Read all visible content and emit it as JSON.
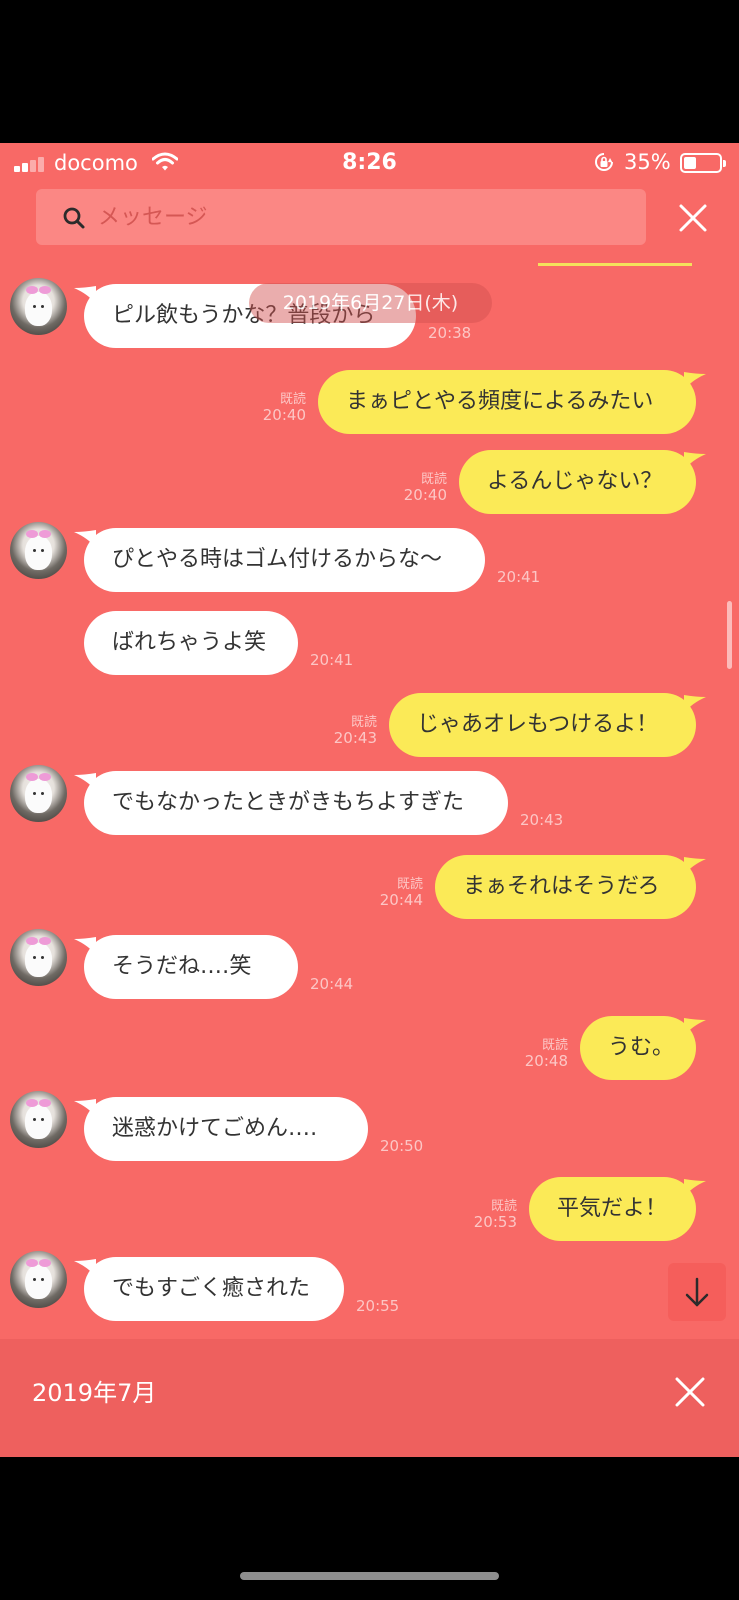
{
  "status_bar": {
    "carrier": "docomo",
    "time": "8:26",
    "battery_percent": "35%",
    "battery_level": 0.35
  },
  "search": {
    "placeholder": "メッセージ"
  },
  "date_label": "2019年6月27日(木)",
  "read_label": "既読",
  "messages": [
    {
      "dir": "in",
      "text": "ピル飲もうかな？普段から",
      "time": "20:38",
      "avatar": true
    },
    {
      "dir": "out",
      "text": "まぁピとやる頻度によるみたい",
      "time": "20:40",
      "read": true
    },
    {
      "dir": "out",
      "text": "よるんじゃない？",
      "time": "20:40",
      "read": true
    },
    {
      "dir": "in",
      "text": "ぴとやる時はゴム付けるからな〜",
      "time": "20:41",
      "avatar": true
    },
    {
      "dir": "in",
      "text": "ばれちゃうよ笑",
      "time": "20:41",
      "avatar": false
    },
    {
      "dir": "out",
      "text": "じゃあオレもつけるよ！",
      "time": "20:43",
      "read": true
    },
    {
      "dir": "in",
      "text": "でもなかったときがきもちよすぎた",
      "time": "20:43",
      "avatar": true
    },
    {
      "dir": "out",
      "text": "まぁそれはそうだろ",
      "time": "20:44",
      "read": true
    },
    {
      "dir": "in",
      "text": "そうだね‥‥笑",
      "time": "20:44",
      "avatar": true
    },
    {
      "dir": "out",
      "text": "うむ。",
      "time": "20:48",
      "read": true
    },
    {
      "dir": "in",
      "text": "迷惑かけてごめん‥‥",
      "time": "20:50",
      "avatar": true
    },
    {
      "dir": "out",
      "text": "平気だよ！",
      "time": "20:53",
      "read": true
    },
    {
      "dir": "in",
      "text": "でもすごく癒された",
      "time": "20:55",
      "avatar": true
    }
  ],
  "bottom_bar": {
    "month": "2019年7月"
  },
  "icons": {
    "search": "search-icon",
    "close": "close-icon",
    "scroll_down": "arrow-down-icon",
    "wifi": "wifi-icon",
    "lock": "orientation-lock-icon",
    "battery": "battery-icon",
    "signal": "signal-icon"
  },
  "colors": {
    "background": "#f86966",
    "incoming_bubble": "#ffffff",
    "outgoing_bubble": "#fbea57",
    "highlight": "#f4e15c"
  }
}
